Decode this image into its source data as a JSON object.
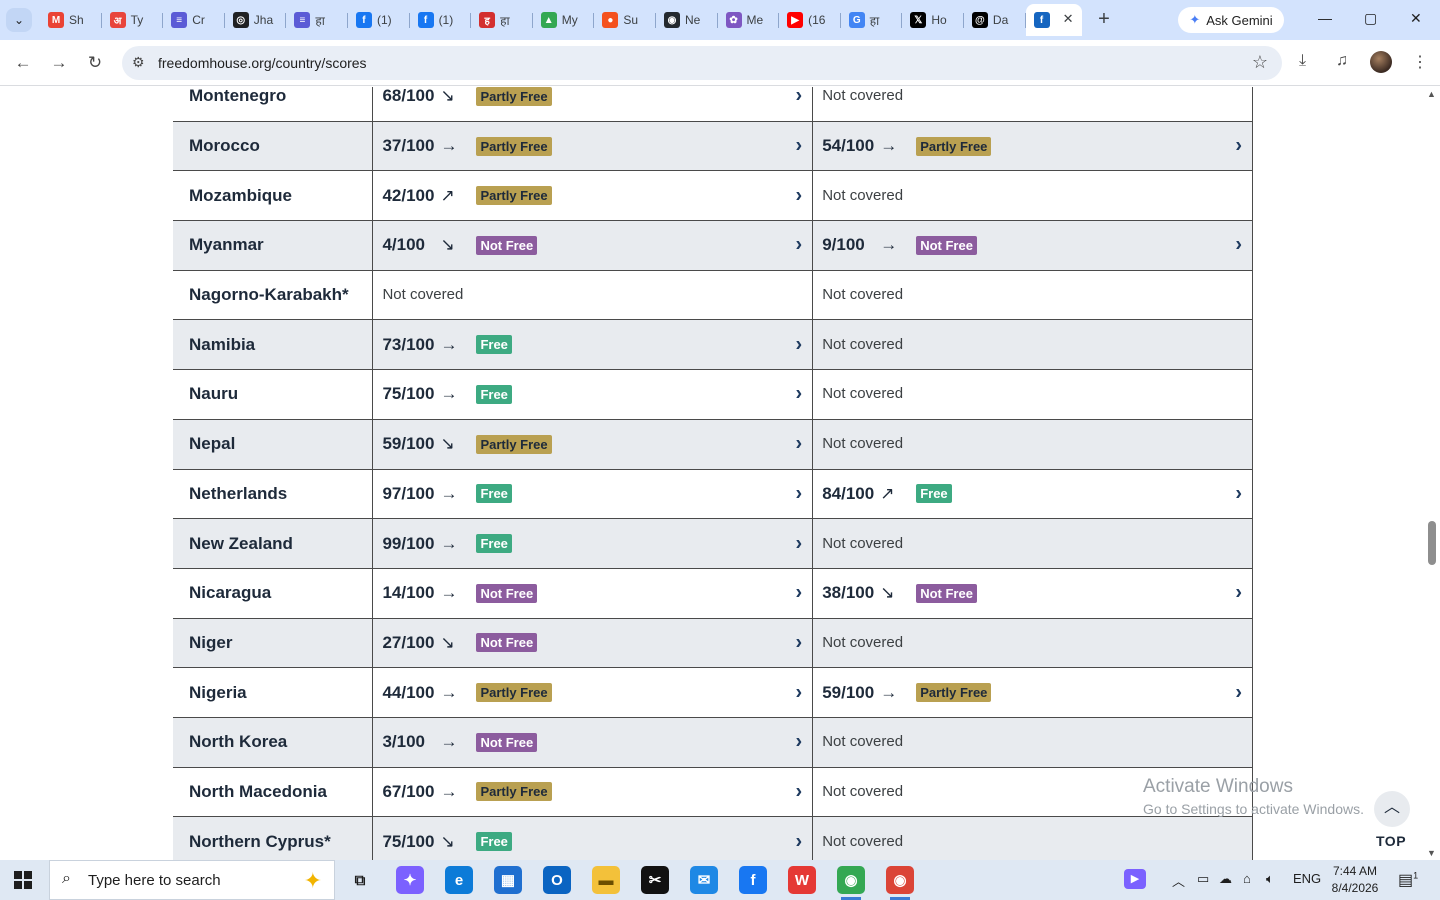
{
  "browser": {
    "tabs": [
      {
        "label": "Sh",
        "icon": "gmail-icon",
        "color": "#ea4335",
        "glyph": "M"
      },
      {
        "label": "Ty",
        "icon": "hindi-news-icon",
        "color": "#e8453c",
        "glyph": "अ"
      },
      {
        "label": "Cr",
        "icon": "site-icon",
        "color": "#5b5bd6",
        "glyph": "≡"
      },
      {
        "label": "Jha",
        "icon": "chatgpt-icon",
        "color": "#202123",
        "glyph": "◎"
      },
      {
        "label": "हा",
        "icon": "site-icon",
        "color": "#5b5bd6",
        "glyph": "≡"
      },
      {
        "label": "(1)",
        "icon": "facebook-icon",
        "color": "#1877f2",
        "glyph": "f"
      },
      {
        "label": "(1)",
        "icon": "facebook-icon",
        "color": "#1877f2",
        "glyph": "f"
      },
      {
        "label": "हा",
        "icon": "hindi-site-icon",
        "color": "#d32f2f",
        "glyph": "ह"
      },
      {
        "label": "My",
        "icon": "google-drive-icon",
        "color": "#34a853",
        "glyph": "▲"
      },
      {
        "label": "Su",
        "icon": "sun-icon",
        "color": "#f4511e",
        "glyph": "●"
      },
      {
        "label": "Ne",
        "icon": "github-icon",
        "color": "#24292e",
        "glyph": "◉"
      },
      {
        "label": "Me",
        "icon": "gear-icon",
        "color": "#7e57c2",
        "glyph": "✿"
      },
      {
        "label": "(16",
        "icon": "youtube-icon",
        "color": "#ff0000",
        "glyph": "▶"
      },
      {
        "label": "हा",
        "icon": "google-icon",
        "color": "#4285f4",
        "glyph": "G"
      },
      {
        "label": "Ho",
        "icon": "x-icon",
        "color": "#000000",
        "glyph": "𝕏"
      },
      {
        "label": "Da",
        "icon": "threads-icon",
        "color": "#000000",
        "glyph": "@"
      }
    ],
    "active_tab": {
      "icon": "freedomhouse-icon",
      "color": "#1565c0",
      "glyph": "f",
      "close": "✕"
    },
    "new_tab": "+",
    "ask_gemini": "Ask Gemini",
    "url": "freedomhouse.org/country/scores"
  },
  "table": {
    "rows": [
      {
        "country": "Montenegro",
        "s1": {
          "score": "68/100",
          "trend": "↘",
          "status": "Partly Free",
          "kind": "partly"
        },
        "s2": {
          "nc": "Not covered"
        }
      },
      {
        "country": "Morocco",
        "s1": {
          "score": "37/100",
          "trend": "→",
          "status": "Partly Free",
          "kind": "partly"
        },
        "s2": {
          "score": "54/100",
          "trend": "→",
          "status": "Partly Free",
          "kind": "partly"
        }
      },
      {
        "country": "Mozambique",
        "s1": {
          "score": "42/100",
          "trend": "↗",
          "status": "Partly Free",
          "kind": "partly"
        },
        "s2": {
          "nc": "Not covered"
        }
      },
      {
        "country": "Myanmar",
        "s1": {
          "score": "4/100",
          "trend": "↘",
          "status": "Not Free",
          "kind": "notfree"
        },
        "s2": {
          "score": "9/100",
          "trend": "→",
          "status": "Not Free",
          "kind": "notfree"
        }
      },
      {
        "country": "Nagorno-Karabakh*",
        "s1": {
          "nc": "Not covered"
        },
        "s2": {
          "nc": "Not covered"
        }
      },
      {
        "country": "Namibia",
        "s1": {
          "score": "73/100",
          "trend": "→",
          "status": "Free",
          "kind": "free"
        },
        "s2": {
          "nc": "Not covered"
        }
      },
      {
        "country": "Nauru",
        "s1": {
          "score": "75/100",
          "trend": "→",
          "status": "Free",
          "kind": "free"
        },
        "s2": {
          "nc": "Not covered"
        }
      },
      {
        "country": "Nepal",
        "s1": {
          "score": "59/100",
          "trend": "↘",
          "status": "Partly Free",
          "kind": "partly"
        },
        "s2": {
          "nc": "Not covered"
        }
      },
      {
        "country": "Netherlands",
        "s1": {
          "score": "97/100",
          "trend": "→",
          "status": "Free",
          "kind": "free"
        },
        "s2": {
          "score": "84/100",
          "trend": "↗",
          "status": "Free",
          "kind": "free"
        }
      },
      {
        "country": "New Zealand",
        "s1": {
          "score": "99/100",
          "trend": "→",
          "status": "Free",
          "kind": "free"
        },
        "s2": {
          "nc": "Not covered"
        }
      },
      {
        "country": "Nicaragua",
        "s1": {
          "score": "14/100",
          "trend": "→",
          "status": "Not Free",
          "kind": "notfree"
        },
        "s2": {
          "score": "38/100",
          "trend": "↘",
          "status": "Not Free",
          "kind": "notfree"
        }
      },
      {
        "country": "Niger",
        "s1": {
          "score": "27/100",
          "trend": "↘",
          "status": "Not Free",
          "kind": "notfree"
        },
        "s2": {
          "nc": "Not covered"
        }
      },
      {
        "country": "Nigeria",
        "s1": {
          "score": "44/100",
          "trend": "→",
          "status": "Partly Free",
          "kind": "partly"
        },
        "s2": {
          "score": "59/100",
          "trend": "→",
          "status": "Partly Free",
          "kind": "partly"
        }
      },
      {
        "country": "North Korea",
        "s1": {
          "score": "3/100",
          "trend": "→",
          "status": "Not Free",
          "kind": "notfree"
        },
        "s2": {
          "nc": "Not covered"
        }
      },
      {
        "country": "North Macedonia",
        "s1": {
          "score": "67/100",
          "trend": "→",
          "status": "Partly Free",
          "kind": "partly"
        },
        "s2": {
          "nc": "Not covered"
        }
      },
      {
        "country": "Northern Cyprus*",
        "s1": {
          "score": "75/100",
          "trend": "↘",
          "status": "Free",
          "kind": "free"
        },
        "s2": {
          "nc": "Not covered"
        }
      }
    ]
  },
  "watermark": {
    "title": "Activate Windows",
    "subtitle": "Go to Settings to activate Windows."
  },
  "top_button": {
    "label": "TOP"
  },
  "taskbar": {
    "search_placeholder": "Type here to search",
    "apps": [
      {
        "name": "task-view-icon",
        "glyph": "⧉",
        "color": "#dfe8f3",
        "fg": "#1e1e1e"
      },
      {
        "name": "copilot-icon",
        "glyph": "✦",
        "color": "#7b61ff",
        "fg": "#fff"
      },
      {
        "name": "edge-icon",
        "glyph": "e",
        "color": "#0c7bd8",
        "fg": "#fff"
      },
      {
        "name": "store-icon",
        "glyph": "▦",
        "color": "#1f6fd0",
        "fg": "#fff"
      },
      {
        "name": "outlook-icon",
        "glyph": "O",
        "color": "#0a64c2",
        "fg": "#fff"
      },
      {
        "name": "file-explorer-icon",
        "glyph": "▬",
        "color": "#f3c13a",
        "fg": "#6b4e00"
      },
      {
        "name": "capcut-icon",
        "glyph": "✂",
        "color": "#111111",
        "fg": "#fff"
      },
      {
        "name": "messenger-icon",
        "glyph": "✉",
        "color": "#1e88e5",
        "fg": "#fff"
      },
      {
        "name": "facebook-icon",
        "glyph": "f",
        "color": "#1877f2",
        "fg": "#fff"
      },
      {
        "name": "wps-office-icon",
        "glyph": "W",
        "color": "#e53935",
        "fg": "#fff"
      },
      {
        "name": "chrome-icon",
        "glyph": "◉",
        "color": "#34a853",
        "fg": "#fff"
      },
      {
        "name": "chrome-profile-icon",
        "glyph": "◉",
        "color": "#db4437",
        "fg": "#fff"
      }
    ],
    "lang": "ENG",
    "time": "7:44 AM",
    "date": "8/4/2026",
    "notif_count": "1"
  }
}
